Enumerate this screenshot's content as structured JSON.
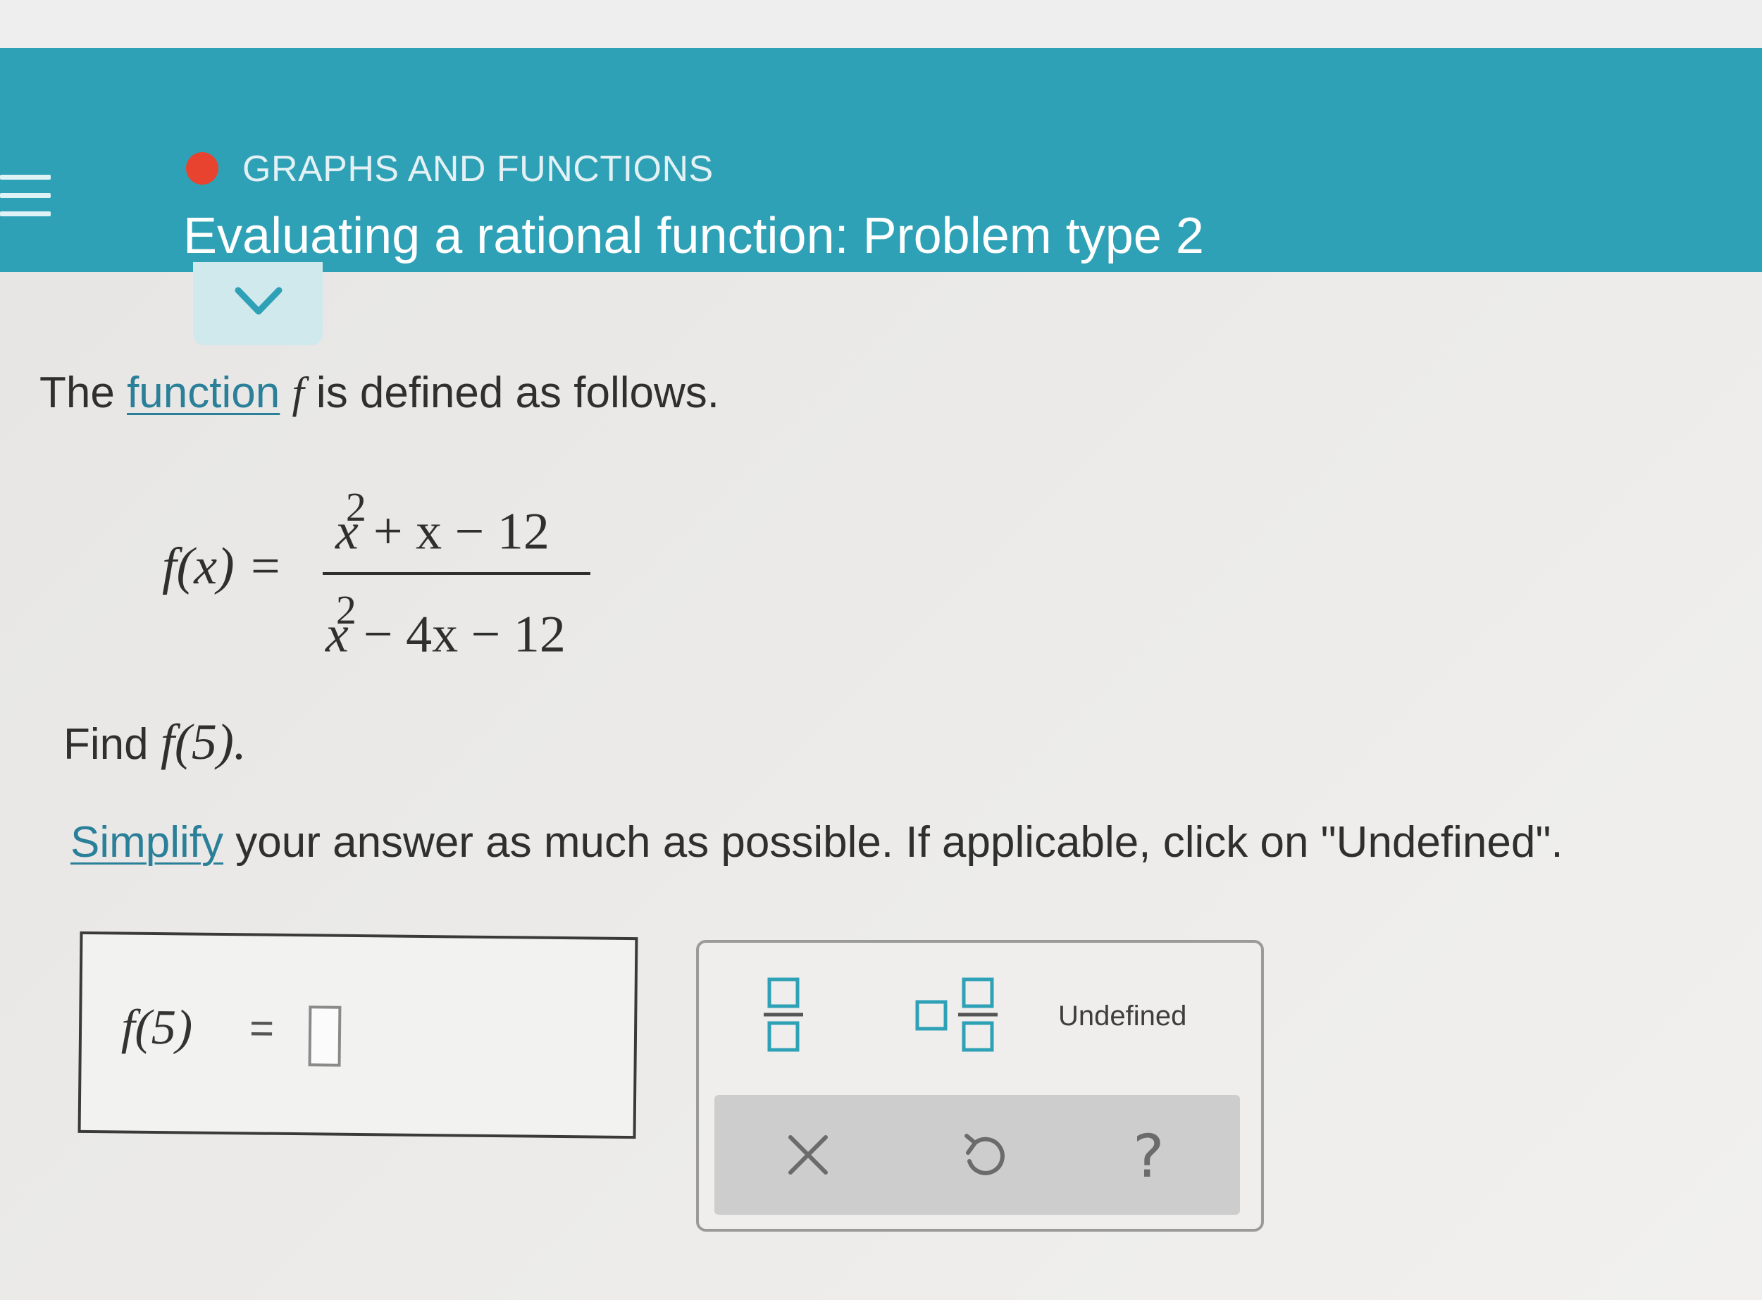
{
  "header": {
    "topic": "GRAPHS AND FUNCTIONS",
    "title": "Evaluating a rational function: Problem type 2",
    "topic_dot_color": "#e8432f",
    "bar_color": "#2ea1b6"
  },
  "icons": {
    "menu": "hamburger-icon",
    "collapse": "chevron-down-icon",
    "fraction": "fraction-icon",
    "mixed_number": "mixed-number-icon",
    "clear": "close-icon",
    "undo": "undo-icon",
    "help": "help-icon"
  },
  "problem": {
    "intro_before": "The ",
    "intro_link": "function",
    "intro_var": "f",
    "intro_after": " is defined as follows.",
    "lhs": "f(x) =",
    "numerator_base": "x",
    "numerator_exp": "2",
    "numerator_rest": "+ x − 12",
    "denominator_base": "x",
    "denominator_exp": "2",
    "denominator_rest": "− 4x − 12",
    "find_label": "Find",
    "find_expr": "f(5).",
    "simplify_link": "Simplify",
    "instruction_rest": " your answer as much as possible. If applicable, click on \"Undefined\"."
  },
  "answer": {
    "label": "f(5)",
    "equals": "=",
    "value": ""
  },
  "keypad": {
    "undefined_label": "Undefined",
    "help_label": "?"
  }
}
